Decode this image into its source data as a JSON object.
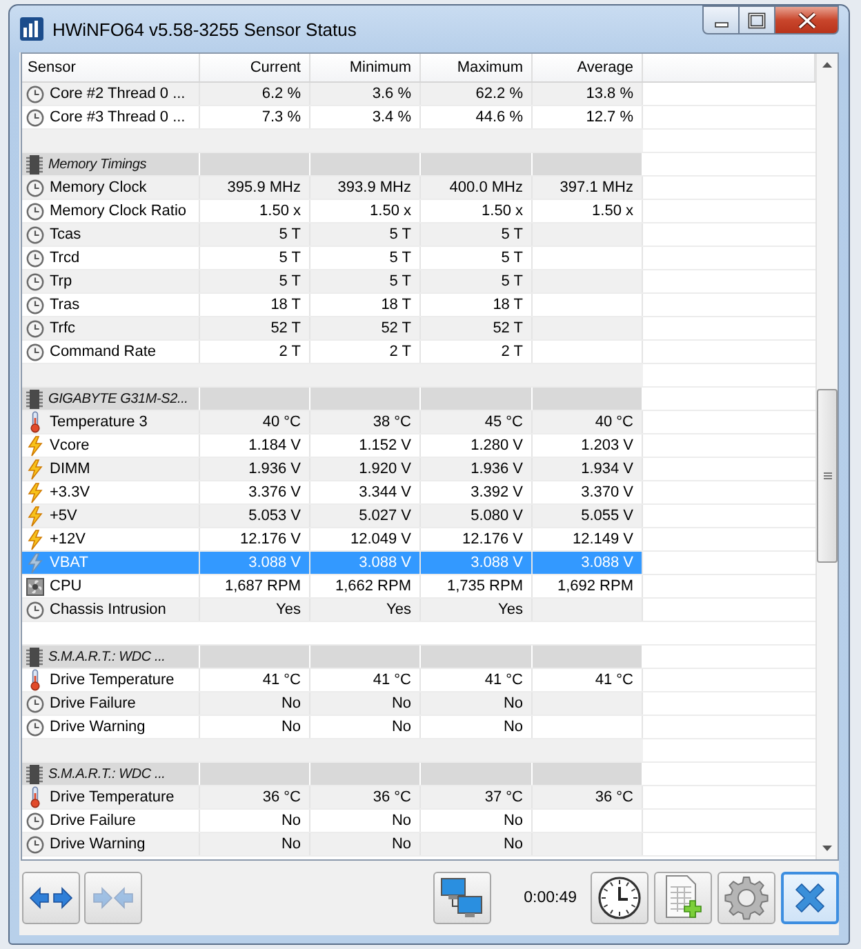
{
  "window": {
    "title": "HWiNFO64 v5.58-3255 Sensor Status"
  },
  "table": {
    "columns": [
      "Sensor",
      "Current",
      "Minimum",
      "Maximum",
      "Average"
    ],
    "rows": [
      {
        "kind": "counter",
        "name": "Core #2 Thread 0 ...",
        "values": [
          "6.2 %",
          "3.6 %",
          "62.2 %",
          "13.8 %"
        ],
        "selected": false
      },
      {
        "kind": "counter",
        "name": "Core #3 Thread 0 ...",
        "values": [
          "7.3 %",
          "3.4 %",
          "44.6 %",
          "12.7 %"
        ],
        "selected": false
      },
      {
        "kind": "blank"
      },
      {
        "kind": "group",
        "name": "Memory Timings"
      },
      {
        "kind": "counter",
        "name": "Memory Clock",
        "values": [
          "395.9 MHz",
          "393.9 MHz",
          "400.0 MHz",
          "397.1 MHz"
        ],
        "selected": false
      },
      {
        "kind": "counter",
        "name": "Memory Clock Ratio",
        "values": [
          "1.50 x",
          "1.50 x",
          "1.50 x",
          "1.50 x"
        ],
        "selected": false
      },
      {
        "kind": "counter",
        "name": "Tcas",
        "values": [
          "5 T",
          "5 T",
          "5 T"
        ],
        "selected": false
      },
      {
        "kind": "counter",
        "name": "Trcd",
        "values": [
          "5 T",
          "5 T",
          "5 T"
        ],
        "selected": false
      },
      {
        "kind": "counter",
        "name": "Trp",
        "values": [
          "5 T",
          "5 T",
          "5 T"
        ],
        "selected": false
      },
      {
        "kind": "counter",
        "name": "Tras",
        "values": [
          "18 T",
          "18 T",
          "18 T"
        ],
        "selected": false
      },
      {
        "kind": "counter",
        "name": "Trfc",
        "values": [
          "52 T",
          "52 T",
          "52 T"
        ],
        "selected": false
      },
      {
        "kind": "counter",
        "name": "Command Rate",
        "values": [
          "2 T",
          "2 T",
          "2 T"
        ],
        "selected": false
      },
      {
        "kind": "blank"
      },
      {
        "kind": "group",
        "name": "GIGABYTE G31M-S2..."
      },
      {
        "kind": "temperature",
        "name": "Temperature 3",
        "values": [
          "40 °C",
          "38 °C",
          "45 °C",
          "40 °C"
        ],
        "selected": false
      },
      {
        "kind": "voltage",
        "name": "Vcore",
        "values": [
          "1.184 V",
          "1.152 V",
          "1.280 V",
          "1.203 V"
        ],
        "selected": false
      },
      {
        "kind": "voltage",
        "name": "DIMM",
        "values": [
          "1.936 V",
          "1.920 V",
          "1.936 V",
          "1.934 V"
        ],
        "selected": false
      },
      {
        "kind": "voltage",
        "name": "+3.3V",
        "values": [
          "3.376 V",
          "3.344 V",
          "3.392 V",
          "3.370 V"
        ],
        "selected": false
      },
      {
        "kind": "voltage",
        "name": "+5V",
        "values": [
          "5.053 V",
          "5.027 V",
          "5.080 V",
          "5.055 V"
        ],
        "selected": false
      },
      {
        "kind": "voltage",
        "name": "+12V",
        "values": [
          "12.176 V",
          "12.049 V",
          "12.176 V",
          "12.149 V"
        ],
        "selected": false
      },
      {
        "kind": "voltage",
        "name": "VBAT",
        "values": [
          "3.088 V",
          "3.088 V",
          "3.088 V",
          "3.088 V"
        ],
        "selected": true
      },
      {
        "kind": "fan",
        "name": "CPU",
        "values": [
          "1,687 RPM",
          "1,662 RPM",
          "1,735 RPM",
          "1,692 RPM"
        ],
        "selected": false
      },
      {
        "kind": "counter",
        "name": "Chassis Intrusion",
        "values": [
          "Yes",
          "Yes",
          "Yes"
        ],
        "selected": false
      },
      {
        "kind": "blank"
      },
      {
        "kind": "group",
        "name": "S.M.A.R.T.: WDC ..."
      },
      {
        "kind": "temperature",
        "name": "Drive Temperature",
        "values": [
          "41 °C",
          "41 °C",
          "41 °C",
          "41 °C"
        ],
        "selected": false
      },
      {
        "kind": "counter",
        "name": "Drive Failure",
        "values": [
          "No",
          "No",
          "No"
        ],
        "selected": false
      },
      {
        "kind": "counter",
        "name": "Drive Warning",
        "values": [
          "No",
          "No",
          "No"
        ],
        "selected": false
      },
      {
        "kind": "blank"
      },
      {
        "kind": "group",
        "name": "S.M.A.R.T.: WDC ..."
      },
      {
        "kind": "temperature",
        "name": "Drive Temperature",
        "values": [
          "36 °C",
          "36 °C",
          "37 °C",
          "36 °C"
        ],
        "selected": false
      },
      {
        "kind": "counter",
        "name": "Drive Failure",
        "values": [
          "No",
          "No",
          "No"
        ],
        "selected": false
      },
      {
        "kind": "counter",
        "name": "Drive Warning",
        "values": [
          "No",
          "No",
          "No"
        ],
        "selected": false
      }
    ]
  },
  "toolbar": {
    "left_buttons": [
      {
        "kind": "expand",
        "disabled": false,
        "focused": false
      },
      {
        "kind": "collapse",
        "disabled": true,
        "focused": false
      }
    ],
    "network_button": {
      "kind": "network",
      "disabled": false,
      "focused": false
    },
    "timer": "0:00:49",
    "right_buttons": [
      {
        "kind": "clock",
        "disabled": false,
        "focused": false
      },
      {
        "kind": "report",
        "disabled": false,
        "focused": false
      },
      {
        "kind": "settings",
        "disabled": false,
        "focused": false
      },
      {
        "kind": "close",
        "disabled": false,
        "focused": true
      }
    ]
  }
}
